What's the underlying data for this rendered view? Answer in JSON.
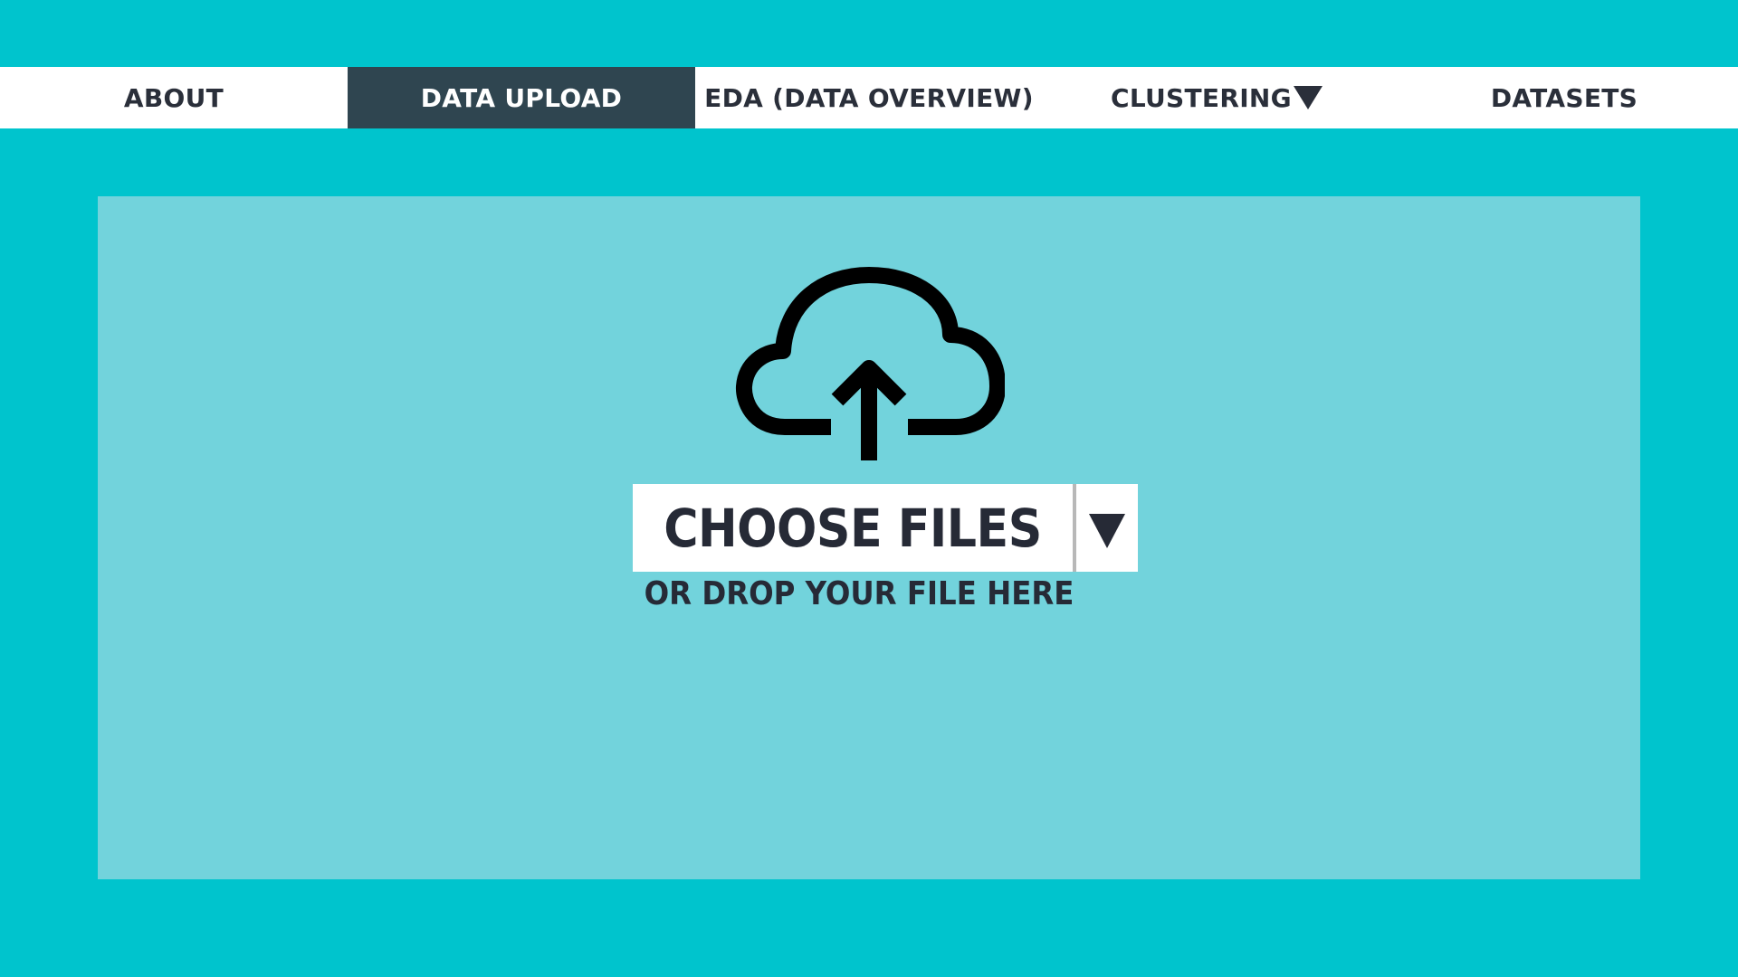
{
  "nav": {
    "items": [
      {
        "label": "ABOUT"
      },
      {
        "label": "DATA UPLOAD",
        "active": true
      },
      {
        "label": "EDA (DATA OVERVIEW)"
      },
      {
        "label": "CLUSTERING",
        "has_dropdown": true
      },
      {
        "label": "DATASETS"
      }
    ]
  },
  "upload": {
    "icon": "cloud-upload-icon",
    "choose_label": "CHOOSE FILES",
    "drop_text": "OR DROP YOUR FILE HERE"
  },
  "colors": {
    "background": "#00c4cd",
    "panel": "#72d3dc",
    "nav_active": "#2f4550",
    "text": "#262a36"
  }
}
